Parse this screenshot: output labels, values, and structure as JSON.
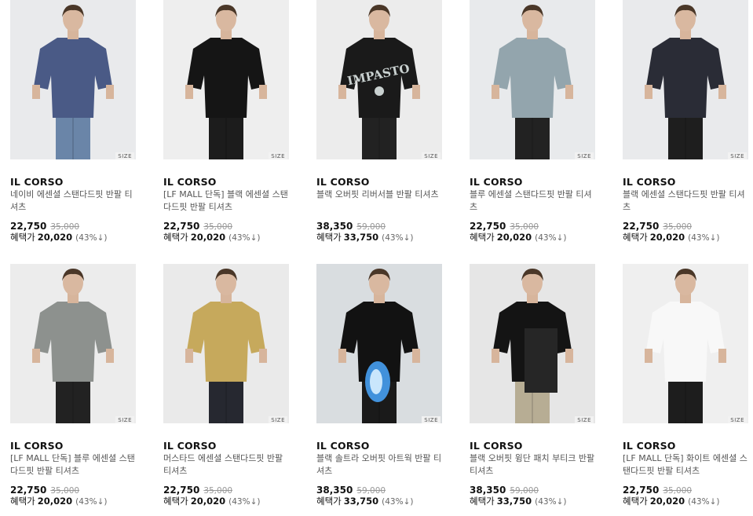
{
  "size_label": "SIZE",
  "benefit_label": "혜택가",
  "products": [
    {
      "brand": "IL CORSO",
      "name": "네이비 에센셜 스탠다드핏 반팔 티셔츠",
      "price": "22,750",
      "original": "35,000",
      "benefit": "20,020",
      "discount": "(43%↓)",
      "bg": "#e9eaec",
      "shirt": "#4a5a86",
      "pants": "#6a85a8",
      "print": ""
    },
    {
      "brand": "IL CORSO",
      "name": "[LF MALL 단독] 블랙 에센셜 스탠다드핏 반팔 티셔츠",
      "price": "22,750",
      "original": "35,000",
      "benefit": "20,020",
      "discount": "(43%↓)",
      "bg": "#eeeeee",
      "shirt": "#151515",
      "pants": "#1c1c1c",
      "print": ""
    },
    {
      "brand": "IL CORSO",
      "name": "블랙 오버핏 리버서블 반팔 티셔츠",
      "price": "38,350",
      "original": "59,000",
      "benefit": "33,750",
      "discount": "(43%↓)",
      "bg": "#ececec",
      "shirt": "#1a1a1a",
      "pants": "#222222",
      "print": "IMPASTO"
    },
    {
      "brand": "IL CORSO",
      "name": "블루 에센셜 스탠다드핏 반팔 티셔츠",
      "price": "22,750",
      "original": "35,000",
      "benefit": "20,020",
      "discount": "(43%↓)",
      "bg": "#e8eaec",
      "shirt": "#93a5ad",
      "pants": "#222222",
      "print": ""
    },
    {
      "brand": "IL CORSO",
      "name": "블랙 에센셜 스탠다드핏 반팔 티셔츠",
      "price": "22,750",
      "original": "35,000",
      "benefit": "20,020",
      "discount": "(43%↓)",
      "bg": "#e9eaec",
      "shirt": "#2a2c36",
      "pants": "#1e1e1e",
      "print": ""
    },
    {
      "brand": "IL CORSO",
      "name": "[LF MALL 단독] 블루 에센셜 스탠다드핏 반팔 티셔츠",
      "price": "22,750",
      "original": "35,000",
      "benefit": "20,020",
      "discount": "(43%↓)",
      "bg": "#ececec",
      "shirt": "#8d918e",
      "pants": "#222222",
      "print": ""
    },
    {
      "brand": "IL CORSO",
      "name": "머스타드 에센셜 스탠다드핏 반팔 티셔츠",
      "price": "22,750",
      "original": "35,000",
      "benefit": "20,020",
      "discount": "(43%↓)",
      "bg": "#eaeaea",
      "shirt": "#c6a95c",
      "pants": "#262830",
      "print": ""
    },
    {
      "brand": "IL CORSO",
      "name": "블랙 솔트라 오버핏 아트웍 반팔 티셔츠",
      "price": "38,350",
      "original": "59,000",
      "benefit": "33,750",
      "discount": "(43%↓)",
      "bg": "#d9dde0",
      "shirt": "#121212",
      "pants": "#1a1a1a",
      "print": "artwork"
    },
    {
      "brand": "IL CORSO",
      "name": "블랙 오버핏 윙단 패치 부티크 반팔 티셔츠",
      "price": "38,350",
      "original": "59,000",
      "benefit": "33,750",
      "discount": "(43%↓)",
      "bg": "#e6e6e6",
      "shirt": "#141414",
      "pants": "#b7ad94",
      "print": "patch"
    },
    {
      "brand": "IL CORSO",
      "name": "[LF MALL 단독] 화이트 에센셜 스탠다드핏 반팔 티셔츠",
      "price": "22,750",
      "original": "35,000",
      "benefit": "20,020",
      "discount": "(43%↓)",
      "bg": "#efefef",
      "shirt": "#f8f8f8",
      "pants": "#1d1d1d",
      "print": ""
    }
  ]
}
